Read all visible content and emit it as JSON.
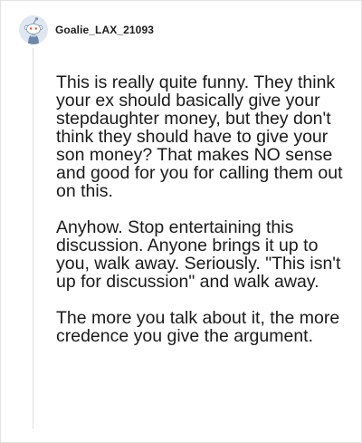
{
  "comment": {
    "username": "Goalie_LAX_21093",
    "avatar_icon": "reddit-snoo-avatar-icon",
    "paragraphs": [
      "This is really quite funny. They think your ex should basically give your stepdaughter money, but they don't think they should have to give your son money? That makes NO sense and good for you for calling them out on this.",
      "Anyhow. Stop entertaining this discussion. Anyone brings it up to you, walk away. Seriously. \"This isn't up for discussion\" and walk away.",
      "The more you talk about it, the more credence you give the argument."
    ]
  }
}
